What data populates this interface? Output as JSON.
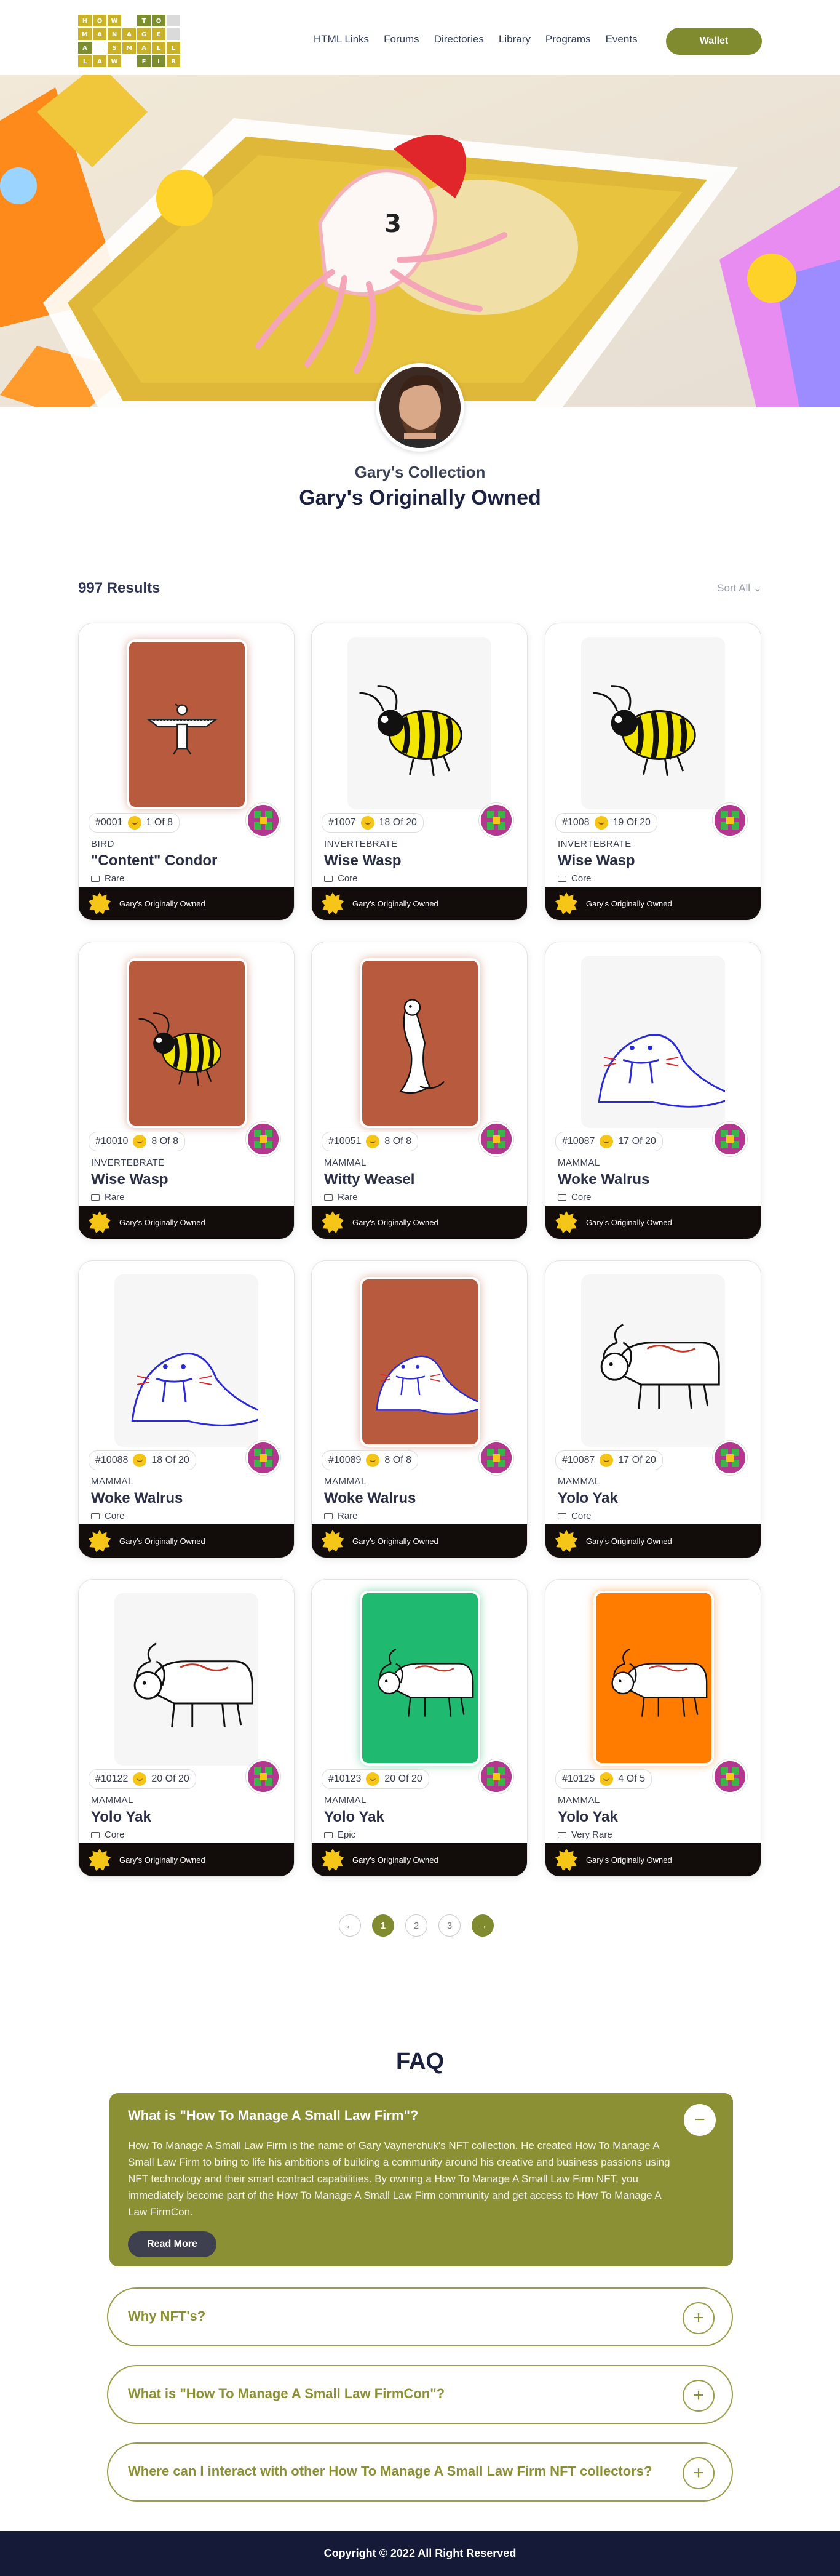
{
  "logo": {
    "rows": [
      [
        "H",
        "O",
        "W",
        "",
        "T",
        "O"
      ],
      [
        "M",
        "A",
        "N",
        "A",
        "G",
        "E"
      ],
      [
        "A",
        "",
        "S",
        "M",
        "A",
        "L",
        "L"
      ],
      [
        "L",
        "A",
        "W",
        "",
        "F",
        "I",
        "R",
        "M"
      ]
    ]
  },
  "nav": {
    "items": [
      "HTML Links",
      "Forums",
      "Directories",
      "Library",
      "Programs",
      "Events"
    ],
    "wallet_label": "Wallet"
  },
  "collection": {
    "subtitle": "Gary's Collection",
    "title": "Gary's Originally Owned"
  },
  "results": {
    "count_label": "997 Results",
    "sort_label": "Sort All"
  },
  "cards": [
    {
      "id": "#0001",
      "edition": "1 Of 8",
      "category": "BIRD",
      "name": "\"Content\" Condor",
      "rarity": "Rare",
      "owner": "Gary's Originally Owned",
      "art": "condor",
      "frame": "rust"
    },
    {
      "id": "#1007",
      "edition": "18 Of 20",
      "category": "INVERTEBRATE",
      "name": "Wise Wasp",
      "rarity": "Core",
      "owner": "Gary's Originally Owned",
      "art": "wasp",
      "frame": "plain"
    },
    {
      "id": "#1008",
      "edition": "19 Of 20",
      "category": "INVERTEBRATE",
      "name": "Wise Wasp",
      "rarity": "Core",
      "owner": "Gary's Originally Owned",
      "art": "wasp",
      "frame": "plain"
    },
    {
      "id": "#10010",
      "edition": "8 Of 8",
      "category": "INVERTEBRATE",
      "name": "Wise Wasp",
      "rarity": "Rare",
      "owner": "Gary's Originally Owned",
      "art": "wasp",
      "frame": "rust"
    },
    {
      "id": "#10051",
      "edition": "8 Of 8",
      "category": "MAMMAL",
      "name": "Witty Weasel",
      "rarity": "Rare",
      "owner": "Gary's Originally Owned",
      "art": "weasel",
      "frame": "rust"
    },
    {
      "id": "#10087",
      "edition": "17 Of 20",
      "category": "MAMMAL",
      "name": "Woke Walrus",
      "rarity": "Core",
      "owner": "Gary's Originally Owned",
      "art": "walrus",
      "frame": "plain"
    },
    {
      "id": "#10088",
      "edition": "18 Of 20",
      "category": "MAMMAL",
      "name": "Woke Walrus",
      "rarity": "Core",
      "owner": "Gary's Originally Owned",
      "art": "walrus",
      "frame": "plain"
    },
    {
      "id": "#10089",
      "edition": "8 Of 8",
      "category": "MAMMAL",
      "name": "Woke Walrus",
      "rarity": "Rare",
      "owner": "Gary's Originally Owned",
      "art": "walrus",
      "frame": "rust"
    },
    {
      "id": "#10087",
      "edition": "17 Of 20",
      "category": "MAMMAL",
      "name": "Yolo Yak",
      "rarity": "Core",
      "owner": "Gary's Originally Owned",
      "art": "yak",
      "frame": "plain"
    },
    {
      "id": "#10122",
      "edition": "20 Of 20",
      "category": "MAMMAL",
      "name": "Yolo Yak",
      "rarity": "Core",
      "owner": "Gary's Originally Owned",
      "art": "yak",
      "frame": "plain"
    },
    {
      "id": "#10123",
      "edition": "20 Of 20",
      "category": "MAMMAL",
      "name": "Yolo Yak",
      "rarity": "Epic",
      "owner": "Gary's Originally Owned",
      "art": "yak",
      "frame": "green"
    },
    {
      "id": "#10125",
      "edition": "4 Of 5",
      "category": "MAMMAL",
      "name": "Yolo Yak",
      "rarity": "Very Rare",
      "owner": "Gary's Originally Owned",
      "art": "yak",
      "frame": "orange"
    }
  ],
  "pagination": {
    "prev_label": "←",
    "pages": [
      "1",
      "2",
      "3"
    ],
    "active_page": "1",
    "next_label": "→"
  },
  "faq": {
    "title": "FAQ",
    "open": {
      "question": "What is \"How To Manage A Small Law Firm\"?",
      "answer": "How To Manage A Small Law Firm is the name of Gary Vaynerchuk's NFT collection. He created How To Manage A Small Law Firm to bring to life his ambitions of building a community around his creative and business passions using NFT technology and their smart contract capabilities. By owning a How To Manage A Small Law Firm NFT, you immediately become part of the How To Manage A Small Law Firm community and get access to How To Manage A Law FirmCon.",
      "read_more": "Read More",
      "toggle": "−"
    },
    "closed": [
      {
        "question": "Why NFT's?",
        "toggle": "+"
      },
      {
        "question": "What is \"How To Manage A Small Law FirmCon\"?",
        "toggle": "+"
      },
      {
        "question": "Where can I interact with other How To Manage A Small Law Firm NFT collectors?",
        "toggle": "+"
      }
    ]
  },
  "footer": {
    "copyright": "Copyright © 2022 All Right Reserved"
  },
  "colors": {
    "accent": "#7f8b2e",
    "faq_open_bg": "#8b9035",
    "footer_bg": "#141a38",
    "card_footer": "#120c0a"
  }
}
